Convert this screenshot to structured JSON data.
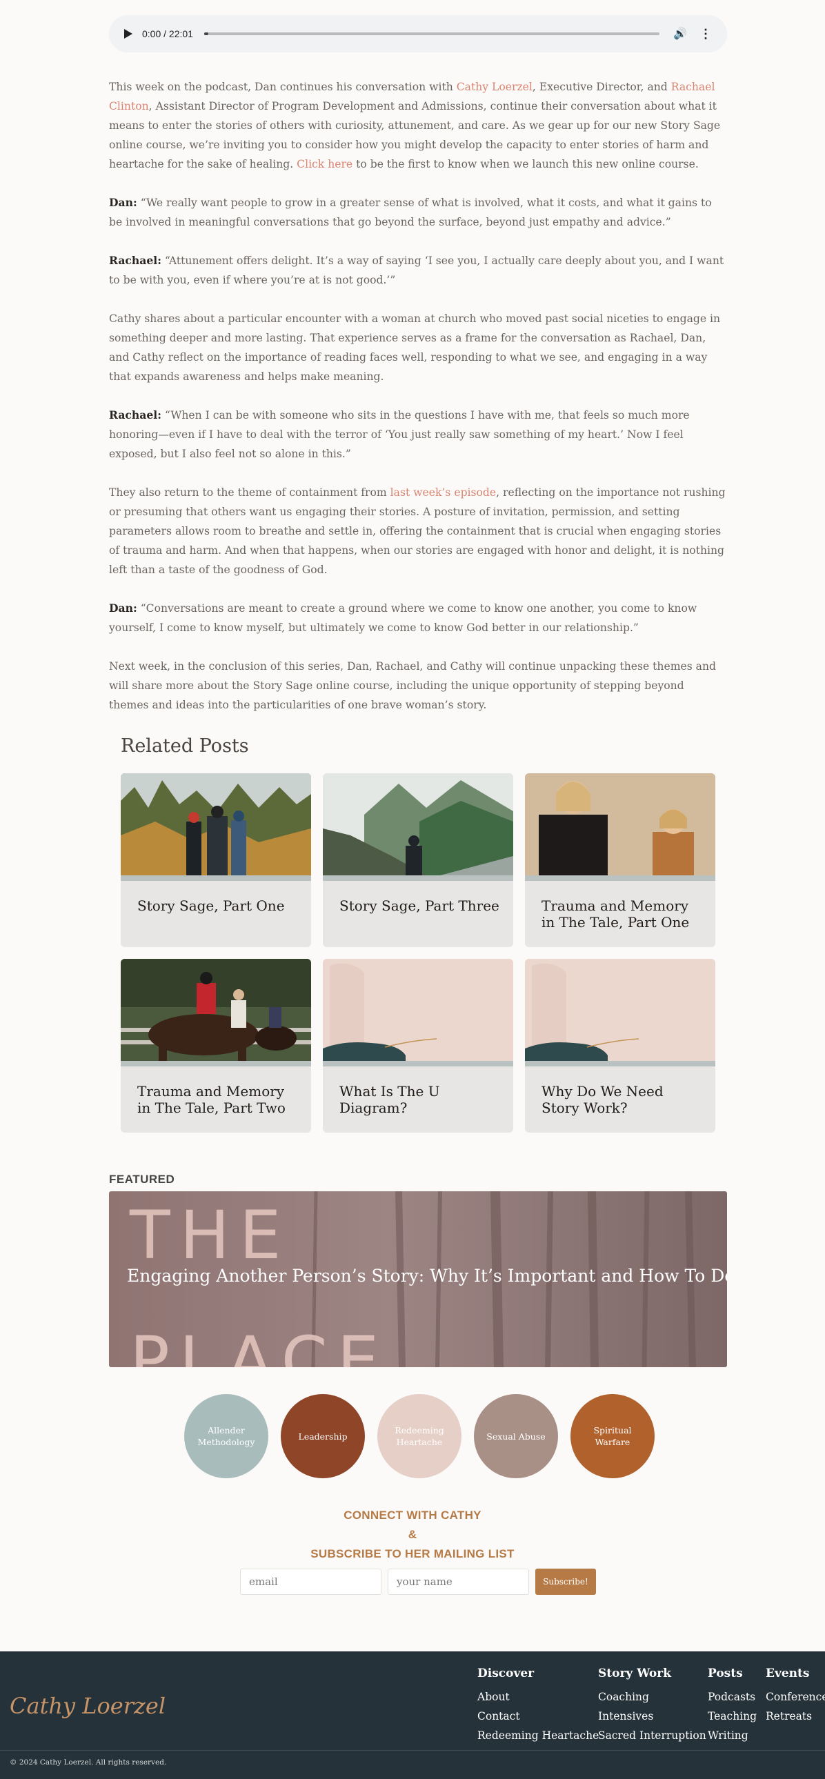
{
  "audio": {
    "time": "0:00 / 22:01",
    "progress": 0
  },
  "article": {
    "p1": {
      "a": "This week on the podcast, Dan continues his conversation with ",
      "link1": "Cathy Loerzel",
      "b": ", Executive Director, and ",
      "link2": "Rachael Clinton",
      "c": ", Assistant Director of Program Development and Admissions, continue their conversation about what it means to enter the stories of others with curiosity, attunement, and care. As we gear up for our new Story Sage online course, we’re inviting you to consider how you might develop the capacity to enter stories of harm and heartache for the sake of healing. ",
      "link3": "Click here",
      "d": " to be the first to know when we launch this new online course."
    },
    "q1": {
      "speaker": "Dan:",
      "text": " “We really want people to grow in a greater sense of what is involved, what it costs, and what it gains to be involved in meaningful conversations that go beyond the surface, beyond just empathy and advice.”"
    },
    "q2": {
      "speaker": "Rachael:",
      "text": " “Attunement offers delight. It’s a way of saying ‘I see you, I actually care deeply about you, and I want to be with you, even if where you’re at is not good.’”"
    },
    "p2": "Cathy shares about a particular encounter with a woman at church who moved past social niceties to engage in something deeper and more lasting. That experience serves as a frame for the conversation as Rachael, Dan, and Cathy reflect on the importance of reading faces well, responding to what we see, and engaging in a way that expands awareness and helps make meaning.",
    "q3": {
      "speaker": "Rachael:",
      "text": " “When I can be with someone who sits in the questions I have with me, that feels so much more honoring—even if I have to deal with the terror of ‘You just really saw something of my heart.’ Now I feel exposed, but I also feel not so alone in this.”"
    },
    "p3": {
      "a": "They also return to the theme of containment from ",
      "link": "last week’s episode",
      "b": ", reflecting on the importance not rushing or presuming that others want us engaging their stories. A posture of invitation, permission, and setting parameters allows room to breathe and settle in, offering the containment that is crucial when engaging stories of trauma and harm. And when that happens, when our stories are engaged with honor and delight, it is nothing left than a taste of the goodness of God."
    },
    "q4": {
      "speaker": "Dan:",
      "text": " “Conversations are meant to create a ground where we come to know one another, you come to know yourself, I come to know myself, but ultimately we come to know God better in our relationship.”"
    },
    "p4": "Next week, in the conclusion of this series, Dan, Rachael, and Cathy will continue unpacking these themes and will share more about the Story Sage online course, including the unique opportunity of stepping beyond themes and ideas into the particularities of one brave woman’s story."
  },
  "related": {
    "title": "Related Posts",
    "posts": [
      {
        "title": "Story Sage, Part One"
      },
      {
        "title": "Story Sage, Part Three"
      },
      {
        "title": "Trauma and Memory in The Tale, Part One"
      },
      {
        "title": "Trauma and Memory in The Tale, Part Two"
      },
      {
        "title": "What Is The U Diagram?"
      },
      {
        "title": "Why Do We Need Story Work?"
      }
    ]
  },
  "featured": {
    "label": "FEATURED",
    "title": "Engaging Another Person’s Story: Why It’s Important and How To Do It",
    "bg_word1": "THE",
    "bg_word2": "PLACE"
  },
  "categories": [
    {
      "label": "Allender Methodology",
      "color": "#a9bcbc"
    },
    {
      "label": "Leadership",
      "color": "#8f4528"
    },
    {
      "label": "Redeeming Heartache",
      "color": "#e6cfc6"
    },
    {
      "label": "Sexual Abuse",
      "color": "#a89087"
    },
    {
      "label": "Spiritual Warfare",
      "color": "#b0612c"
    }
  ],
  "connect": {
    "line1": "CONNECT WITH CATHY",
    "line2": "&",
    "line3": "SUBSCRIBE TO HER MAILING LIST",
    "email_placeholder": "email",
    "name_placeholder": "your name",
    "button": "Subscribe!"
  },
  "footer": {
    "logo": "Cathy Loerzel",
    "columns": [
      {
        "title": "Discover",
        "links": [
          "About",
          "Contact",
          "Redeeming Heartache"
        ]
      },
      {
        "title": "Story Work",
        "links": [
          "Coaching",
          "Intensives",
          "Sacred Interruption"
        ]
      },
      {
        "title": "Posts",
        "links": [
          "Podcasts",
          "Teaching",
          "Writing"
        ]
      },
      {
        "title": "Events",
        "links": [
          "Conferences",
          "Retreats"
        ]
      }
    ],
    "copyright": "© 2024 Cathy Loerzel. All rights reserved."
  },
  "colors": {
    "accent": "#d98470",
    "brand": "#b57a45",
    "footer_bg": "#253239"
  }
}
